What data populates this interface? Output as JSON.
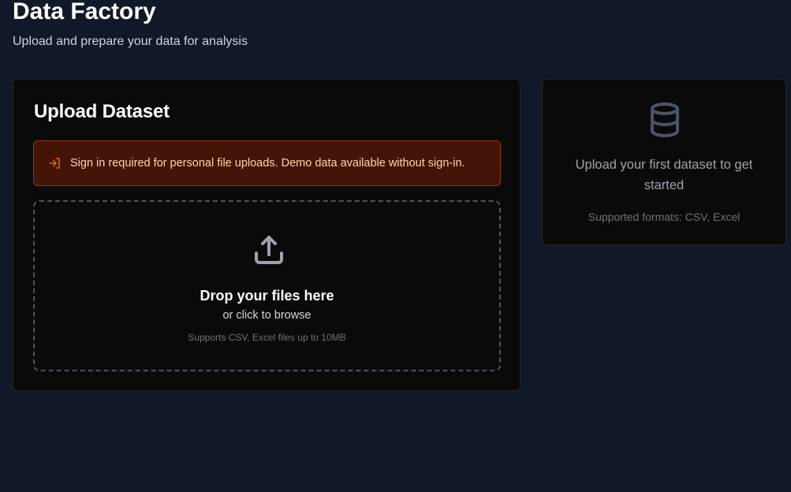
{
  "header": {
    "title": "Data Factory",
    "subtitle": "Upload and prepare your data for analysis"
  },
  "upload_card": {
    "title": "Upload Dataset",
    "alert": {
      "icon": "sign-in-icon",
      "text": "Sign in required for personal file uploads. Demo data available without sign-in."
    },
    "dropzone": {
      "icon": "upload-icon",
      "title": "Drop your files here",
      "subtitle": "or click to browse",
      "note": "Supports CSV, Excel files up to 10MB"
    }
  },
  "empty_state": {
    "icon": "database-icon",
    "message": "Upload your first dataset to get started",
    "formats": "Supported formats: CSV, Excel"
  },
  "colors": {
    "background": "#111827",
    "card": "#0b0a0a",
    "alert_background": "#431407",
    "alert_border": "#9a3412",
    "alert_text": "#fed7aa",
    "icon_accent": "#f97316",
    "muted_icon": "#4b5563"
  }
}
